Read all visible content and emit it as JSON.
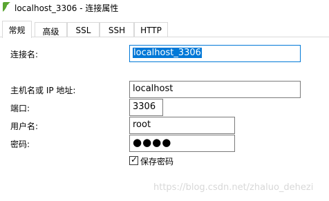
{
  "window": {
    "title": "localhost_3306 - 连接属性"
  },
  "tabs": [
    {
      "label": "常规",
      "active": true
    },
    {
      "label": "高级",
      "active": false
    },
    {
      "label": "SSL",
      "active": false
    },
    {
      "label": "SSH",
      "active": false
    },
    {
      "label": "HTTP",
      "active": false
    }
  ],
  "form": {
    "connection_name": {
      "label": "连接名:",
      "value": "localhost_3306"
    },
    "host": {
      "label": "主机名或 IP 地址:",
      "value": "localhost"
    },
    "port": {
      "label": "端口:",
      "value": "3306"
    },
    "username": {
      "label": "用户名:",
      "value": "root"
    },
    "password": {
      "label": "密码:",
      "value": "●●●●"
    },
    "save_password": {
      "label": "保存密码",
      "checked": true
    }
  },
  "watermark": "https://blog.csdn.net/zhaluo_dehezi",
  "colors": {
    "selection": "#0078d7",
    "field_border": "#7a7a7a",
    "tab_border": "#d9d9d9",
    "app_icon": "#5aa532"
  }
}
